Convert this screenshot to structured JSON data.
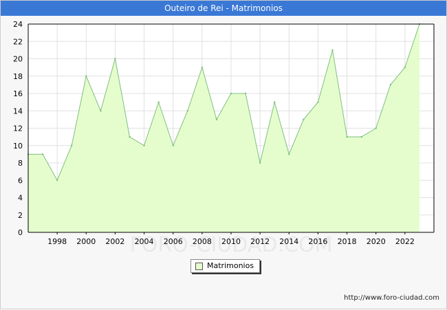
{
  "title": "Outeiro de Rei - Matrimonios",
  "watermark": "FORO-CIUDAD.COM",
  "credit": "http://www.foro-ciudad.com",
  "colors": {
    "titlebar": "#3a78d6",
    "fill": "#e5fdcd",
    "line": "#7fbf7f",
    "grid": "#e0e0e0"
  },
  "chart_data": {
    "type": "area",
    "title": "Outeiro de Rei - Matrimonios",
    "xlabel": "",
    "ylabel": "",
    "x": [
      1996,
      1997,
      1998,
      1999,
      2000,
      2001,
      2002,
      2003,
      2004,
      2005,
      2006,
      2007,
      2008,
      2009,
      2010,
      2011,
      2012,
      2013,
      2014,
      2015,
      2016,
      2017,
      2018,
      2019,
      2020,
      2021,
      2022,
      2023
    ],
    "series": [
      {
        "name": "Matrimonios",
        "values": [
          9,
          9,
          6,
          10,
          18,
          14,
          20,
          11,
          10,
          15,
          10,
          14,
          19,
          13,
          16,
          16,
          8,
          15,
          9,
          13,
          15,
          21,
          11,
          11,
          12,
          17,
          19,
          24
        ]
      }
    ],
    "xticks": [
      "1998",
      "2000",
      "2002",
      "2004",
      "2006",
      "2008",
      "2010",
      "2012",
      "2014",
      "2016",
      "2018",
      "2020",
      "2022"
    ],
    "yticks": [
      "0",
      "2",
      "4",
      "6",
      "8",
      "10",
      "12",
      "14",
      "16",
      "18",
      "20",
      "22",
      "24"
    ],
    "xlim": [
      1996,
      2024
    ],
    "ylim": [
      0,
      24
    ],
    "grid": true,
    "legend_position": "bottom-center"
  }
}
